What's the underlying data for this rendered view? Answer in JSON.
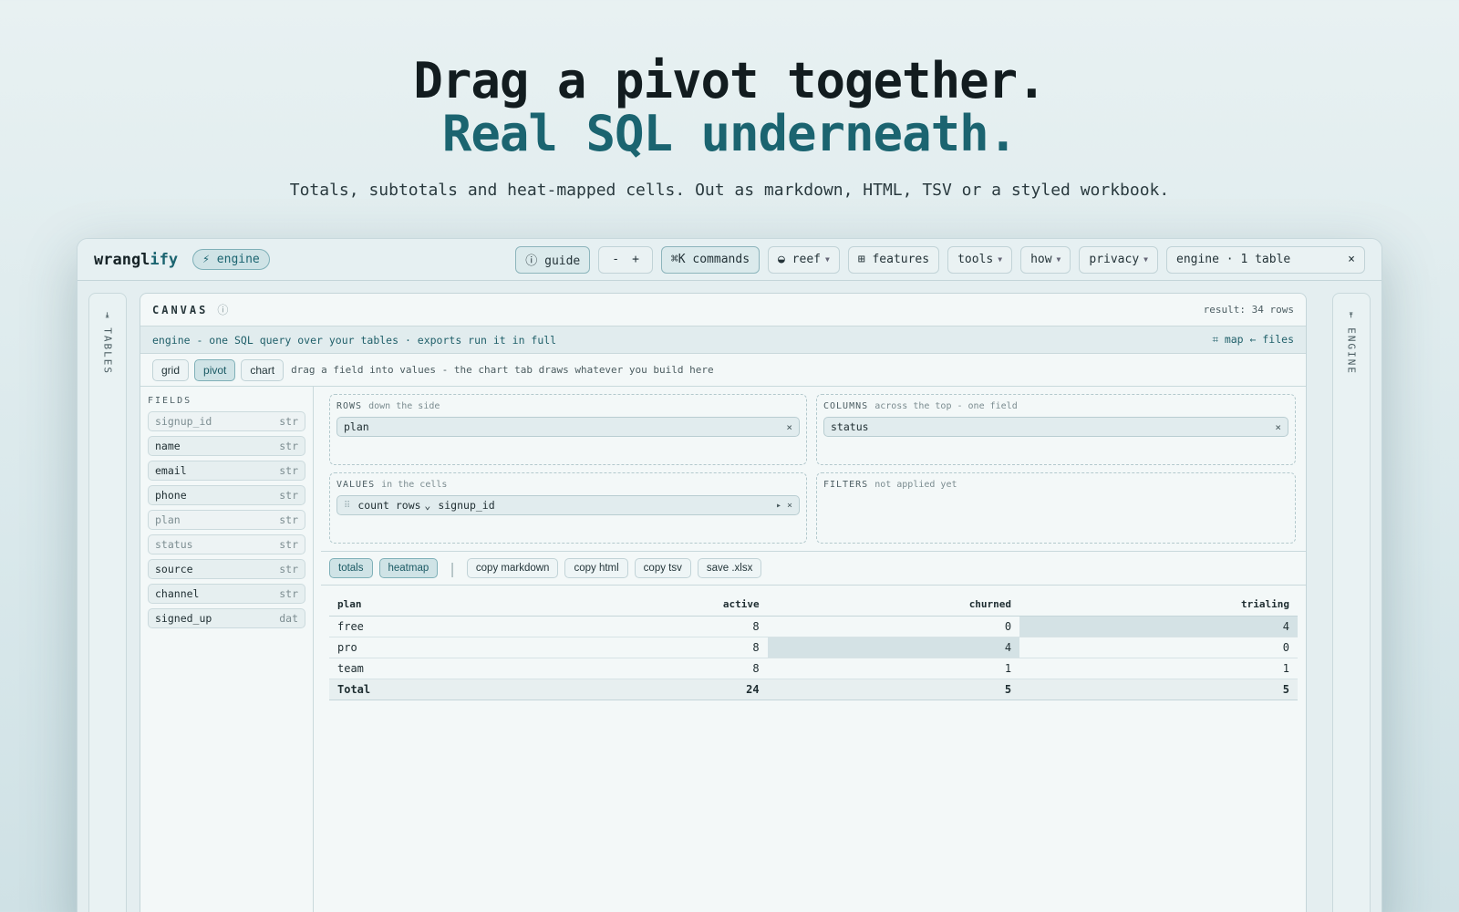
{
  "hero": {
    "line1": "Drag a pivot together.",
    "line2": "Real SQL underneath.",
    "subtitle": "Totals, subtotals and heat-mapped cells. Out as markdown, HTML, TSV or a styled workbook."
  },
  "topbar": {
    "brand_prefix": "wrangl",
    "brand_suffix": "ify",
    "engine_badge": "⚡ engine",
    "guide": "ⓘ guide",
    "zoom_out": "-",
    "zoom_in": "+",
    "commands": "⌘K commands",
    "theme": "◒ reef",
    "features": "⊞ features",
    "tools": "tools",
    "how": "how",
    "privacy": "privacy",
    "engine_status": "engine · 1 table",
    "close": "×"
  },
  "rails": {
    "left": "⇥ TABLES",
    "right": "⇤ ENGINE"
  },
  "canvas": {
    "title": "CANVAS",
    "info": "ⓘ",
    "result": "result: 34 rows",
    "banner": "engine - one SQL query over your tables · exports run it in full",
    "banner_links": "⌗ map  ← files",
    "modes": [
      "grid",
      "pivot",
      "chart"
    ],
    "mode_hint": "drag a field into values - the chart tab draws whatever you build here"
  },
  "fields": {
    "label": "FIELDS",
    "items": [
      {
        "name": "signup_id",
        "type": "str",
        "muted": true
      },
      {
        "name": "name",
        "type": "str",
        "muted": false
      },
      {
        "name": "email",
        "type": "str",
        "muted": false
      },
      {
        "name": "phone",
        "type": "str",
        "muted": false
      },
      {
        "name": "plan",
        "type": "str",
        "muted": true
      },
      {
        "name": "status",
        "type": "str",
        "muted": true
      },
      {
        "name": "source",
        "type": "str",
        "muted": false
      },
      {
        "name": "channel",
        "type": "str",
        "muted": false
      },
      {
        "name": "signed_up",
        "type": "dat",
        "muted": false
      }
    ]
  },
  "zones": {
    "rows": {
      "label": "ROWS",
      "sub": "down the side",
      "chip": "plan"
    },
    "columns": {
      "label": "COLUMNS",
      "sub": "across the top - one field",
      "chip": "status"
    },
    "values": {
      "label": "VALUES",
      "sub": "in the cells",
      "agg": "count rows",
      "field": "signup_id"
    },
    "filters": {
      "label": "FILTERS",
      "sub": "not applied yet"
    }
  },
  "actions": {
    "totals": "totals",
    "heatmap": "heatmap",
    "copy_markdown": "copy markdown",
    "copy_html": "copy html",
    "copy_tsv": "copy tsv",
    "save_xlsx": "save .xlsx"
  },
  "pivot": {
    "headers": [
      "plan",
      "active",
      "churned",
      "trialing"
    ],
    "rows": [
      {
        "label": "free",
        "values": [
          "8",
          "0",
          "4"
        ],
        "heat": [
          false,
          false,
          true
        ]
      },
      {
        "label": "pro",
        "values": [
          "8",
          "4",
          "0"
        ],
        "heat": [
          false,
          true,
          false
        ]
      },
      {
        "label": "team",
        "values": [
          "8",
          "1",
          "1"
        ],
        "heat": [
          false,
          false,
          false
        ]
      }
    ],
    "total": {
      "label": "Total",
      "values": [
        "24",
        "5",
        "5"
      ]
    }
  }
}
